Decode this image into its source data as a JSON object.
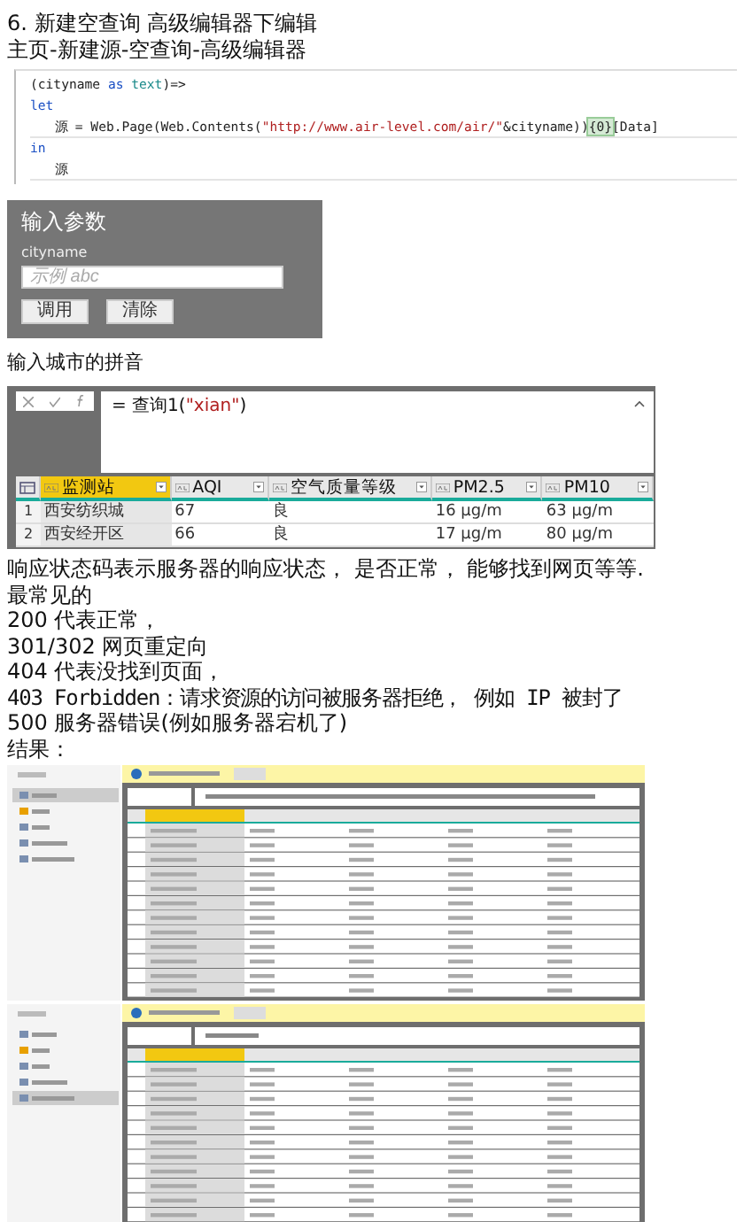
{
  "heading": "6.  新建空查询 高级编辑器下编辑",
  "path": "主页-新建源-空查询-高级编辑器",
  "code_lines": [
    {
      "indented": false,
      "tokens": [
        {
          "kind": "plain",
          "text": "(cityname "
        },
        {
          "kind": "keyword",
          "text": "as "
        },
        {
          "kind": "type",
          "text": "text"
        },
        {
          "kind": "plain",
          "text": ")=>"
        }
      ]
    },
    {
      "indented": false,
      "tokens": [
        {
          "kind": "keyword",
          "text": "let"
        }
      ]
    },
    {
      "indented": true,
      "tokens": [
        {
          "kind": "plain",
          "text": "源 = Web.Page(Web.Contents("
        },
        {
          "kind": "string",
          "text": "\"http://www.air-level.com/air/\""
        },
        {
          "kind": "plain",
          "text": "&cityname))"
        },
        {
          "kind": "highlight",
          "text": "{0}"
        },
        {
          "kind": "plain",
          "text": "[Data]"
        }
      ]
    },
    {
      "indented": false,
      "tokens": [
        {
          "kind": "keyword",
          "text": "in"
        }
      ]
    },
    {
      "indented": true,
      "tokens": [
        {
          "kind": "plain",
          "text": "源"
        }
      ]
    }
  ],
  "dialog": {
    "title": "输入参数",
    "field_label": "cityname",
    "placeholder": "示例 abc",
    "buttons": [
      "调用",
      "清除"
    ]
  },
  "caption": "输入城市的拼音",
  "preview": {
    "formula_prefix": "= 查询1(",
    "formula_arg": "\"xian\"",
    "formula_suffix": ")",
    "columns": [
      {
        "label": "监测站",
        "selected": true
      },
      {
        "label": "AQI",
        "selected": false
      },
      {
        "label": "空气质量等级",
        "selected": false
      },
      {
        "label": "PM2.5",
        "selected": false
      },
      {
        "label": "PM10",
        "selected": false
      }
    ],
    "rows": [
      {
        "number": "1",
        "cells": [
          "西安纺织城",
          "67",
          "良",
          "16 μg/m",
          "63 μg/m"
        ]
      },
      {
        "number": "2",
        "cells": [
          "西安经开区",
          "66",
          "良",
          "17 μg/m",
          "80 μg/m"
        ]
      }
    ]
  },
  "status_lines": [
    {
      "kind": "prose",
      "text": "响应状态码表示服务器的响应状态， 是否正常， 能够找到网页等等."
    },
    {
      "kind": "prose",
      "text": "最常见的"
    },
    {
      "kind": "prose",
      "text": "200 代表正常，"
    },
    {
      "kind": "prose",
      "text": "301/302 网页重定向"
    },
    {
      "kind": "prose",
      "text": "404 代表没找到页面，"
    },
    {
      "kind": "mono",
      "text": "403  Forbidden：请求资源的访问被服务器拒绝， 例如 IP 被封了"
    },
    {
      "kind": "prose",
      "text": "500 服务器错误(例如服务器宕机了)"
    },
    {
      "kind": "prose",
      "text": "结果："
    }
  ]
}
